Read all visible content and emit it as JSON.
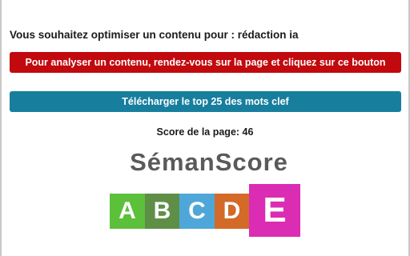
{
  "prompt": "Vous souhaitez optimiser un contenu pour : rédaction ia",
  "buttons": {
    "analyze": "Pour analyser un contenu, rendez-vous sur la page et cliquez sur ce bouton",
    "download": "Télécharger le top 25 des mots clef"
  },
  "score": {
    "text": "Score de la page: 46",
    "value": 46
  },
  "brand": "SémanScore",
  "grades": {
    "labels": [
      "A",
      "B",
      "C",
      "D",
      "E"
    ],
    "current": "E"
  },
  "colors": {
    "analyze_button": "#c2090d",
    "download_button": "#177e9e",
    "grade_a": "#5dc03a",
    "grade_b": "#5f8f47",
    "grade_c": "#4ea7d8",
    "grade_d": "#d36a28",
    "grade_e": "#db2cb4"
  }
}
